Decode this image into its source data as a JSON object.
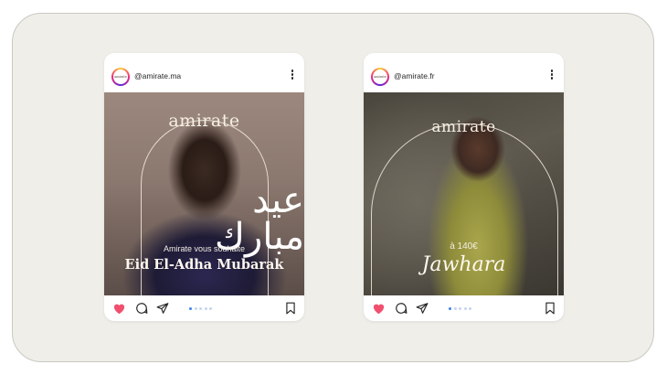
{
  "posts": [
    {
      "username": "@amirate.ma",
      "avatar_text": "amirate",
      "brand": "amirate",
      "arabic_text": "عيد مبارك",
      "subtitle": "Amirate vous souhaite",
      "headline": "Eid El-Adha Mubarak",
      "carousel": {
        "count": 5,
        "active_index": 0
      }
    },
    {
      "username": "@amirate.fr",
      "avatar_text": "amirate",
      "brand": "amirate",
      "subtitle": "à 140€",
      "headline": "Jawhara",
      "carousel": {
        "count": 5,
        "active_index": 0
      }
    }
  ],
  "icons": {
    "heart": "heart-icon",
    "comment": "comment-icon",
    "share": "share-icon",
    "save": "bookmark-icon",
    "more": "more-options-icon"
  },
  "colors": {
    "background": "#efeee9",
    "heart": "#f0506e",
    "carousel_active": "#3b82f6",
    "carousel_inactive": "#c6d4ee"
  }
}
